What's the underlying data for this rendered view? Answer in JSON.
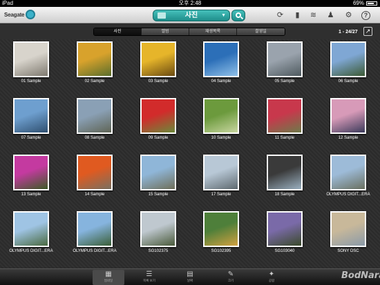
{
  "status_bar": {
    "device": "iPad",
    "time": "오후 2:48",
    "battery": "69%"
  },
  "app": {
    "logo": "Seagate",
    "title": "사진",
    "icons": [
      "refresh-icon",
      "device-icon",
      "wifi-icon",
      "users-icon",
      "gear-icon",
      "help-icon"
    ]
  },
  "segments": [
    {
      "label": "사진",
      "active": true
    },
    {
      "label": "앨범",
      "active": false
    },
    {
      "label": "재생목록",
      "active": false
    },
    {
      "label": "촬영일",
      "active": false
    }
  ],
  "pager": "1 - 24/27",
  "photos": [
    {
      "caption": "01 Sample",
      "colors": [
        "#d8d4cc",
        "#7f7a70"
      ]
    },
    {
      "caption": "02 Sample",
      "colors": [
        "#d8a22c",
        "#5a6e2c"
      ]
    },
    {
      "caption": "03 Sample",
      "colors": [
        "#e6b52a",
        "#6b4b12"
      ]
    },
    {
      "caption": "04 Sample",
      "colors": [
        "#2c6fb8",
        "#8fc0e8"
      ]
    },
    {
      "caption": "05 Sample",
      "colors": [
        "#9aa3ad",
        "#4f5a5f"
      ]
    },
    {
      "caption": "06 Sample",
      "colors": [
        "#7fa7d4",
        "#3c5a34"
      ]
    },
    {
      "caption": "07 Sample",
      "colors": [
        "#6e9fcf",
        "#2f4f6f"
      ]
    },
    {
      "caption": "08 Sample",
      "colors": [
        "#8aa0b5",
        "#5f6455"
      ]
    },
    {
      "caption": "09 Sample",
      "colors": [
        "#d22b2b",
        "#6a8a3a"
      ]
    },
    {
      "caption": "10 Sample",
      "colors": [
        "#6c9a3d",
        "#c8d6a0"
      ]
    },
    {
      "caption": "11 Sample",
      "colors": [
        "#c8384c",
        "#6d7a4a"
      ]
    },
    {
      "caption": "12 Sample",
      "colors": [
        "#d79ab8",
        "#3a3a5a"
      ]
    },
    {
      "caption": "13 Sample",
      "colors": [
        "#c43aa0",
        "#3d5a26"
      ]
    },
    {
      "caption": "14 Sample",
      "colors": [
        "#e05a20",
        "#7a7060"
      ]
    },
    {
      "caption": "15 Sample",
      "colors": [
        "#8fb6d8",
        "#6f6f5a"
      ]
    },
    {
      "caption": "17 Sample",
      "colors": [
        "#b8c8d6",
        "#5f6a70"
      ]
    },
    {
      "caption": "18 Sample",
      "colors": [
        "#3a3a3a",
        "#9ab0c0"
      ]
    },
    {
      "caption": "OLYMPUS DIGIT...ERA",
      "colors": [
        "#9dbbd8",
        "#6a7060"
      ]
    },
    {
      "caption": "OLYMPUS DIGIT...ERA",
      "colors": [
        "#9fc4e4",
        "#4a6a40"
      ]
    },
    {
      "caption": "OLYMPUS DIGIT...ERA",
      "colors": [
        "#86b4de",
        "#3a5e36"
      ]
    },
    {
      "caption": "SG102375",
      "colors": [
        "#bfc8cf",
        "#4a5a3a"
      ]
    },
    {
      "caption": "SG102395",
      "colors": [
        "#4e7f3a",
        "#d0a040"
      ]
    },
    {
      "caption": "SG103040",
      "colors": [
        "#7a6aa8",
        "#3a4a2a"
      ]
    },
    {
      "caption": "SONY DSC",
      "colors": [
        "#c8b89a",
        "#8a9aa8"
      ]
    }
  ],
  "tabs": [
    {
      "label": "썸네일",
      "icon": "grid-icon",
      "active": true
    },
    {
      "label": "목록 보기",
      "icon": "list-icon",
      "active": false
    },
    {
      "label": "날짜",
      "icon": "calendar-icon",
      "active": false
    },
    {
      "label": "크기",
      "icon": "ruler-icon",
      "active": false
    },
    {
      "label": "공람",
      "icon": "star-icon",
      "active": false
    }
  ],
  "watermark": "BodNara"
}
